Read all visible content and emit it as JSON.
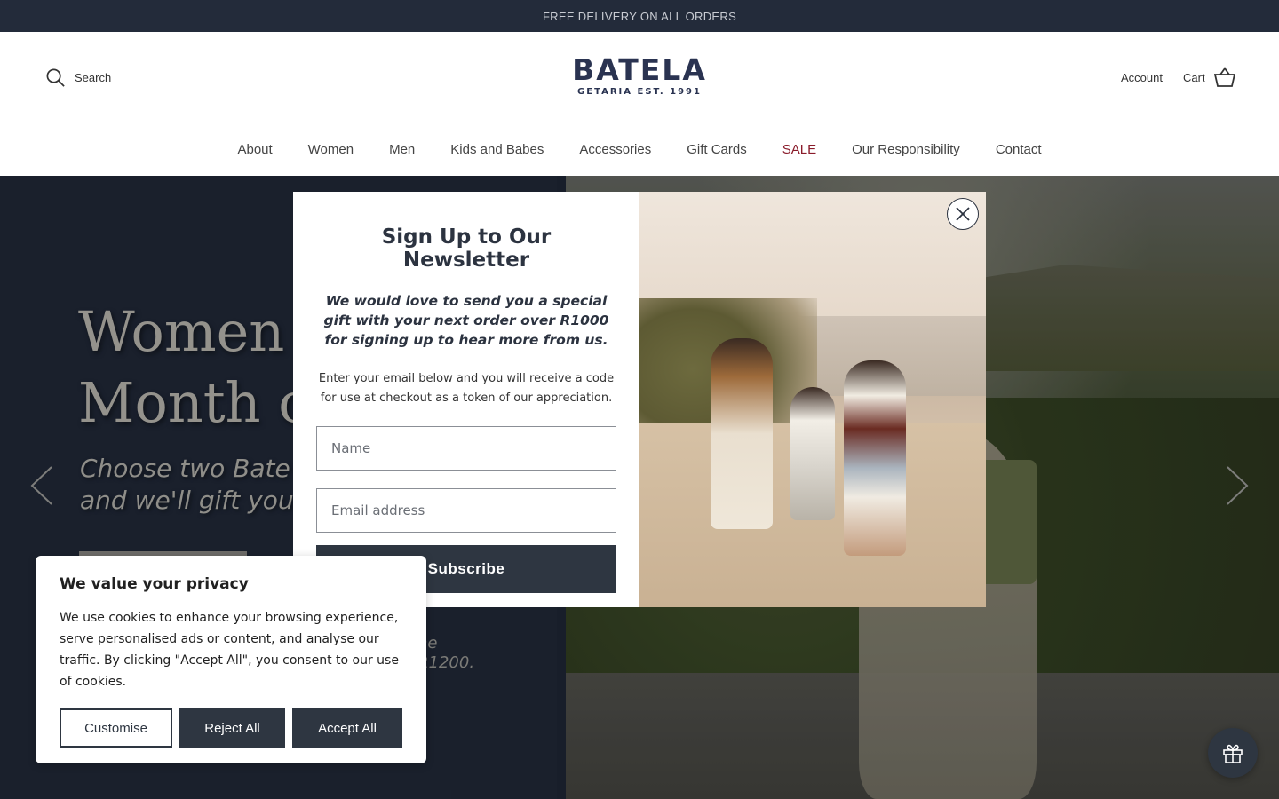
{
  "announcement": "FREE DELIVERY ON ALL ORDERS",
  "header": {
    "search_label": "Search",
    "logo_main": "BATELA",
    "logo_sub": "GETARIA EST. 1991",
    "account_label": "Account",
    "cart_label": "Cart"
  },
  "nav": {
    "items": [
      "About",
      "Women",
      "Men",
      "Kids and Babes",
      "Accessories",
      "Gift Cards",
      "SALE",
      "Our Responsibility",
      "Contact"
    ]
  },
  "hero": {
    "title_line1": "Women",
    "title_line2": "Month o",
    "sub_line1": "Choose two Bate",
    "sub_line2": "and we'll gift you",
    "small_line1": "he",
    "small_line2": "R1200."
  },
  "newsletter": {
    "title": "Sign Up to Our Newsletter",
    "lead": "We would love to send you a special gift with your next order over R1000 for signing up to hear more from us.",
    "description": "Enter your email below and you will receive a code for use at checkout as a token of our appreciation.",
    "name_placeholder": "Name",
    "email_placeholder": "Email address",
    "subscribe_label": "Subscribe"
  },
  "cookie": {
    "title": "We value your privacy",
    "text": "We use cookies to enhance your browsing experience, serve personalised ads or content, and analyse our traffic. By clicking \"Accept All\", you consent to our use of cookies.",
    "customise_label": "Customise",
    "reject_label": "Reject All",
    "accept_label": "Accept All"
  },
  "colors": {
    "brand_navy": "#2a3351",
    "dark_bar": "#232b3a",
    "button_dark": "#2e3641",
    "sale_red": "#8a1c2b"
  }
}
